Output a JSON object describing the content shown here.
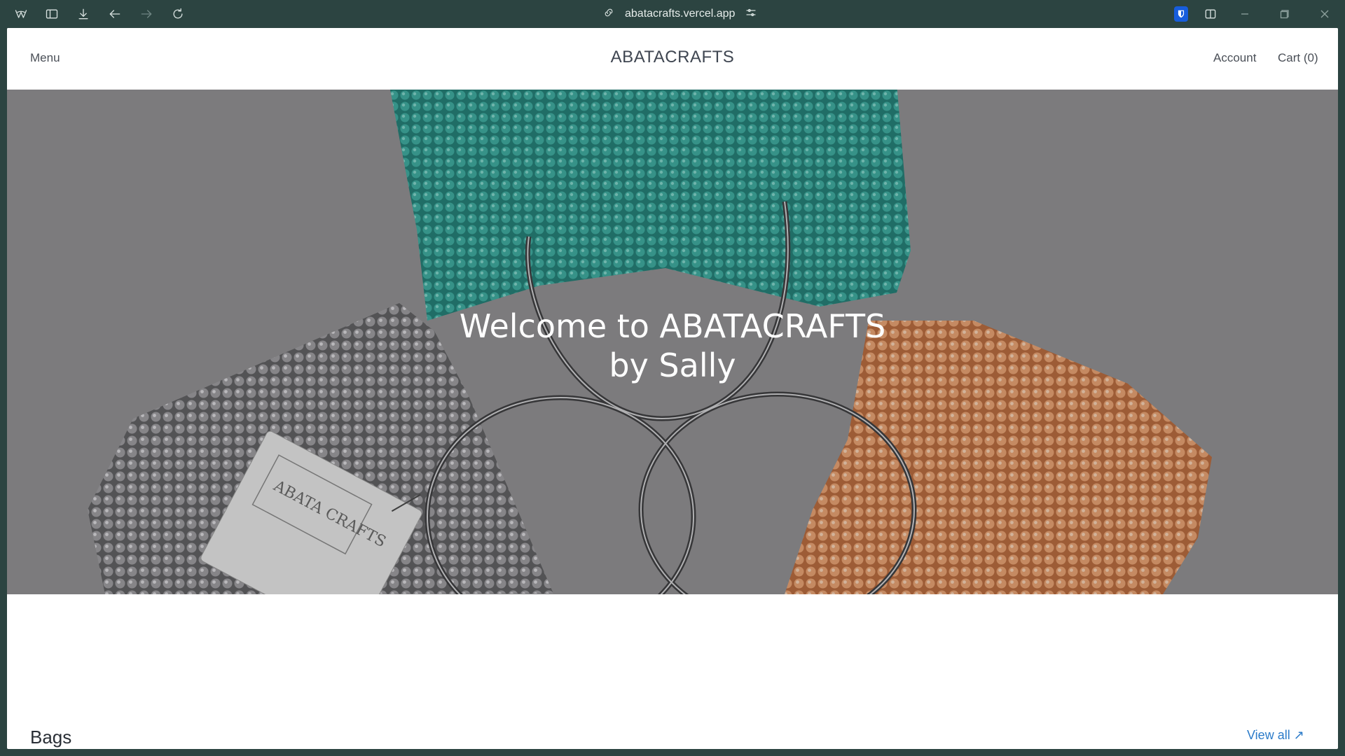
{
  "browser": {
    "url": "abatacrafts.vercel.app",
    "icons": {
      "app": "browser-logo-icon",
      "sidebar": "sidebar-toggle-icon",
      "downloads": "download-icon",
      "back": "back-arrow-icon",
      "forward": "forward-arrow-icon",
      "reload": "reload-icon",
      "link": "link-icon",
      "site_settings": "sliders-icon",
      "extension": "bitwarden-shield-icon",
      "split": "split-view-icon",
      "minimize": "minimize-icon",
      "maximize": "maximize-icon",
      "close": "close-icon"
    },
    "accent": "#2c4441"
  },
  "header": {
    "menu_label": "Menu",
    "brand": "ABATACRAFTS",
    "account_label": "Account",
    "cart_label": "Cart (0)"
  },
  "hero": {
    "title_line1": "Welcome to ABATACRAFTS",
    "title_line2": "by Sally",
    "tag_text": "ABATA CRAFTS"
  },
  "collection": {
    "title": "Bags",
    "view_all_label": "View all"
  },
  "colors": {
    "bag_teal": "#2f9f94",
    "bag_grey": "#9a9a9c",
    "bag_peach": "#e8a070",
    "link_blue": "#2b7bc9"
  }
}
